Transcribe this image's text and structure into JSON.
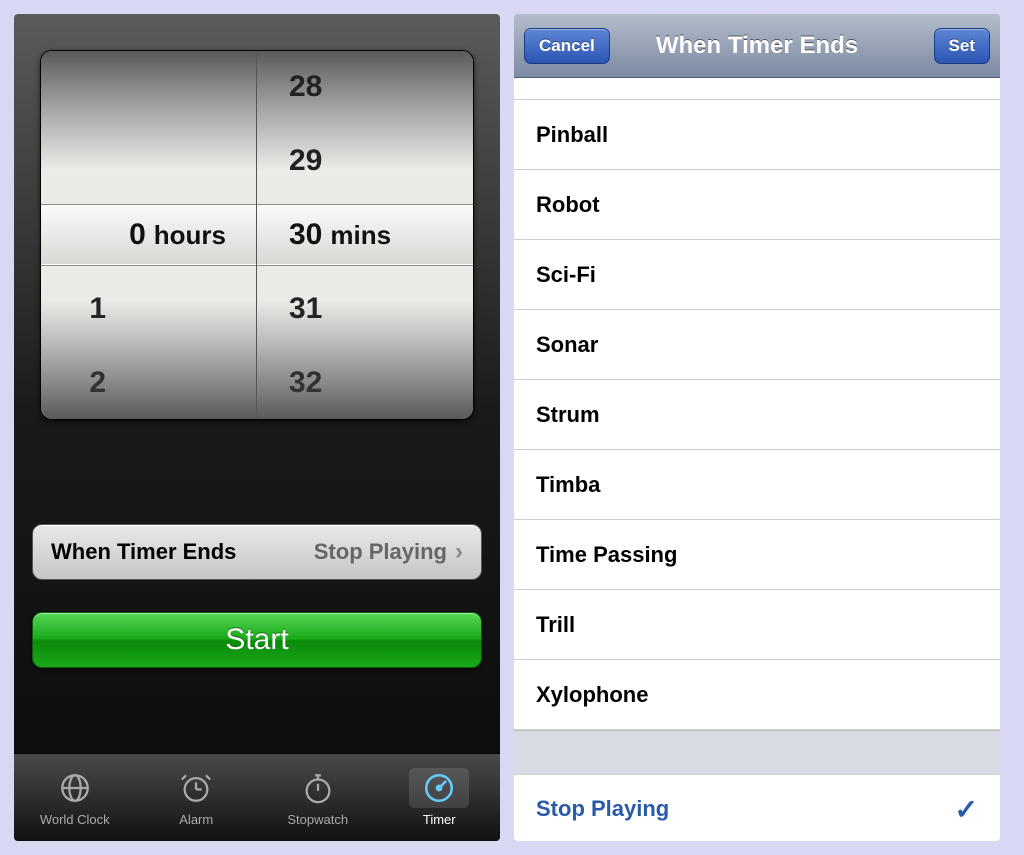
{
  "timer": {
    "picker": {
      "hours": {
        "selected": "0",
        "below": [
          "1",
          "2"
        ],
        "unit": "hours"
      },
      "mins": {
        "selected": "30",
        "above": [
          "28",
          "29"
        ],
        "below": [
          "31",
          "32"
        ],
        "unit": "mins"
      }
    },
    "whenTimerEnds": {
      "label": "When Timer Ends",
      "value": "Stop Playing"
    },
    "start": "Start",
    "tabs": {
      "worldClock": "World Clock",
      "alarm": "Alarm",
      "stopwatch": "Stopwatch",
      "timer": "Timer",
      "active": "timer"
    }
  },
  "soundPicker": {
    "title": "When Timer Ends",
    "cancel": "Cancel",
    "set": "Set",
    "sounds": [
      "Pinball",
      "Robot",
      "Sci-Fi",
      "Sonar",
      "Strum",
      "Timba",
      "Time Passing",
      "Trill",
      "Xylophone"
    ],
    "stopPlaying": "Stop Playing",
    "selected": "Stop Playing"
  }
}
